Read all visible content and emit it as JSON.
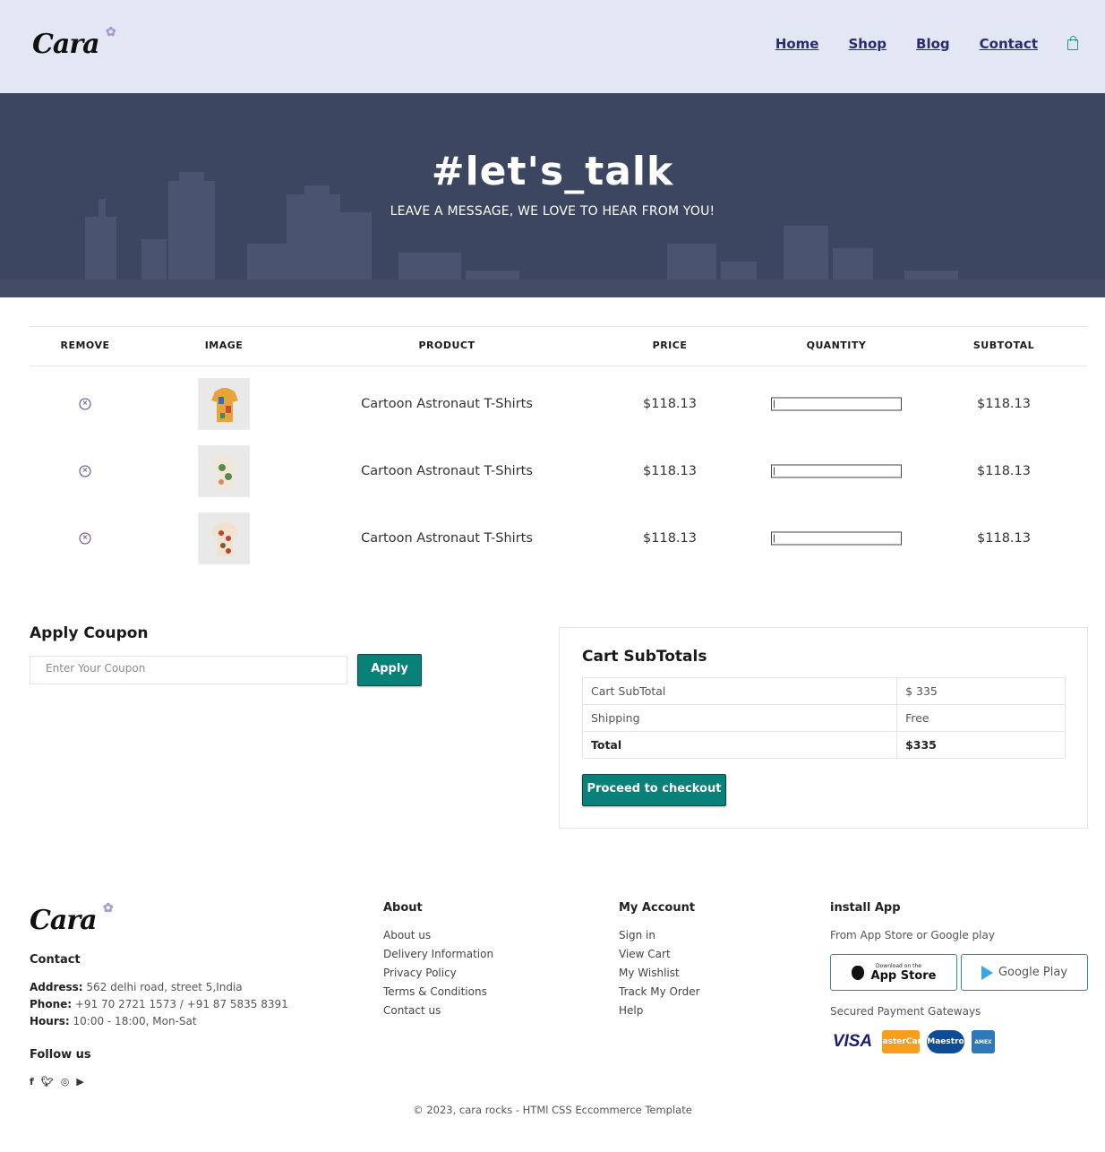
{
  "brand": {
    "logo_text": "Cara"
  },
  "nav": {
    "items": [
      "Home",
      "Shop",
      "Blog",
      "Contact"
    ]
  },
  "hero": {
    "title": "#let's_talk",
    "subtitle": "LEAVE A MESSAGE, WE LOVE TO HEAR FROM YOU!"
  },
  "cart": {
    "headers": [
      "REMOVE",
      "IMAGE",
      "PRODUCT",
      "PRICE",
      "QUANTITY",
      "SUBTOTAL"
    ],
    "rows": [
      {
        "product": "Cartoon Astronaut T-Shirts",
        "price": "$118.13",
        "quantity": "1",
        "subtotal": "$118.13"
      },
      {
        "product": "Cartoon Astronaut T-Shirts",
        "price": "$118.13",
        "quantity": "1",
        "subtotal": "$118.13"
      },
      {
        "product": "Cartoon Astronaut T-Shirts",
        "price": "$118.13",
        "quantity": "1",
        "subtotal": "$118.13"
      }
    ]
  },
  "coupon": {
    "title": "Apply Coupon",
    "placeholder": "Enter Your Coupon",
    "button": "Apply"
  },
  "subtotals": {
    "title": "Cart SubTotals",
    "rows": [
      {
        "label": "Cart SubTotal",
        "value": "$ 335"
      },
      {
        "label": "Shipping",
        "value": "Free"
      },
      {
        "label": "Total",
        "value": "$335"
      }
    ],
    "button": "Proceed to checkout"
  },
  "footer": {
    "contact": {
      "title": "Contact",
      "address_label": "Address:",
      "address": " 562 delhi road, street 5,India",
      "phone_label": "Phone:",
      "phone": " +91 70 2721 1573 / +91 87 5835 8391",
      "hours_label": "Hours:",
      "hours": " 10:00 - 18:00, Mon-Sat"
    },
    "follow": {
      "title": "Follow us"
    },
    "about": {
      "title": "About",
      "links": [
        "About us",
        "Delivery Information",
        "Privacy Policy",
        "Terms & Conditions",
        "Contact us"
      ]
    },
    "account": {
      "title": "My Account",
      "links": [
        "Sign in",
        "View Cart",
        "My Wishlist",
        "Track My Order",
        "Help"
      ]
    },
    "install": {
      "title": "install App",
      "subtitle": "From App Store or Google play",
      "appstore_small": "Download on the",
      "appstore_big": "App Store",
      "googleplay": "Google Play",
      "payments_title": "Secured Payment Gateways",
      "payments": [
        "VISA",
        "MasterCard",
        "Maestro",
        "AMEX"
      ]
    },
    "copyright": "© 2023, cara rocks - HTMl CSS Eccommerce Template"
  }
}
